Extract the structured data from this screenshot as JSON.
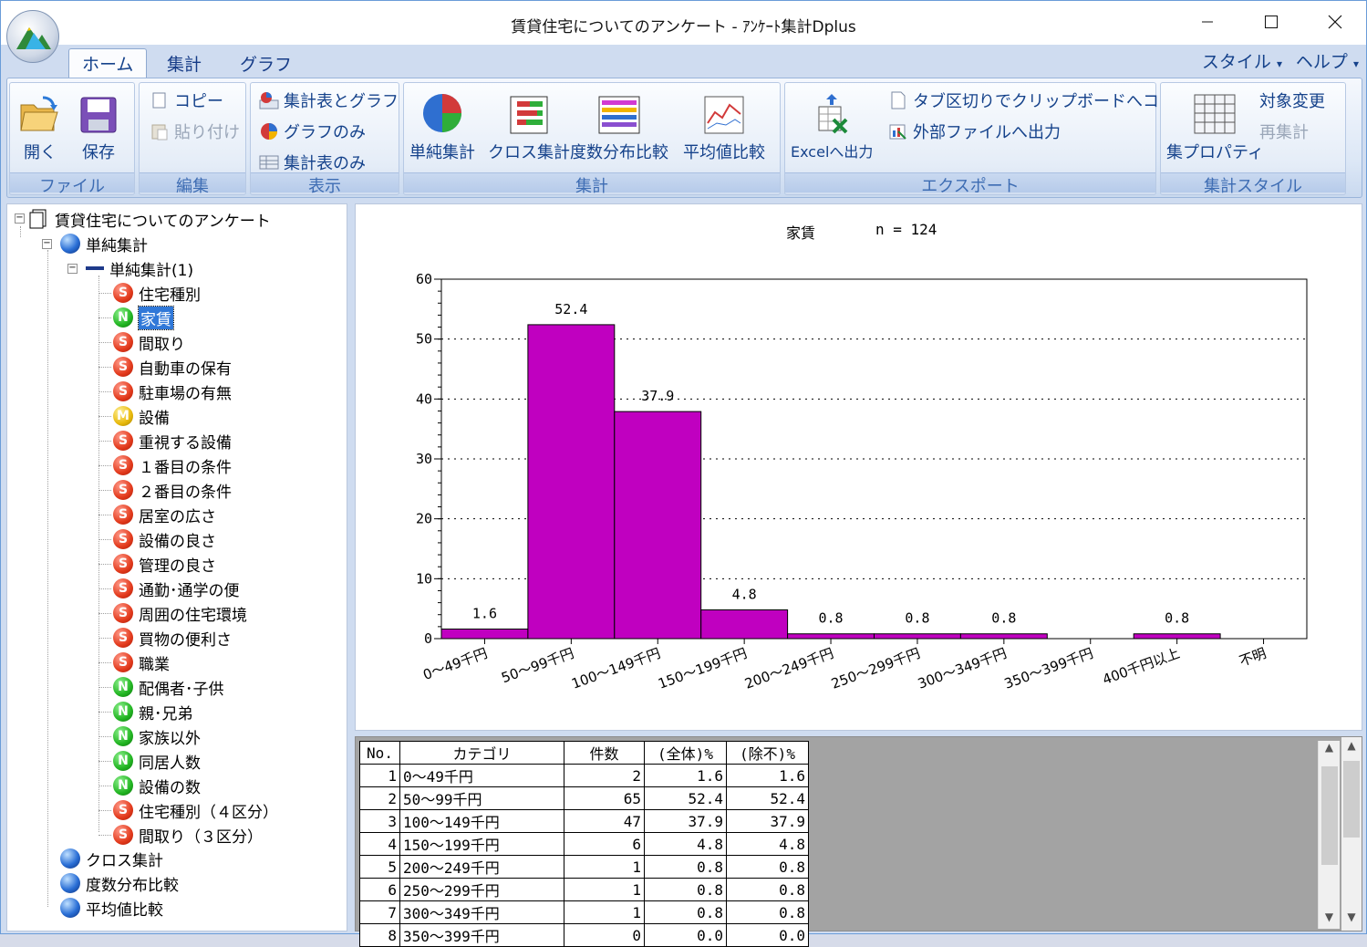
{
  "window": {
    "title": "賃貸住宅についてのアンケート - ｱﾝｹｰﾄ集計Dplus"
  },
  "tabs": {
    "home": "ホーム",
    "tally": "集計",
    "graph": "グラフ",
    "style": "スタイル",
    "help": "ヘルプ"
  },
  "ribbon": {
    "file": {
      "label": "ファイル",
      "open": "開く",
      "save": "保存"
    },
    "edit": {
      "label": "編集",
      "copy": "コピー",
      "paste": "貼り付け"
    },
    "view": {
      "label": "表示",
      "table_graph": "集計表とグラフ",
      "graph_only": "グラフのみ",
      "table_only": "集計表のみ"
    },
    "tally": {
      "label": "集計",
      "simple": "単純集計",
      "cross": "クロス集計",
      "freq": "度数分布比較",
      "mean": "平均値比較"
    },
    "export": {
      "label": "エクスポート",
      "excel": "Excelへ出力",
      "clipboard": "タブ区切りでクリップボードへコピー",
      "external": "外部ファイルへ出力"
    },
    "tally_style": {
      "label": "集計スタイル",
      "props": "集プロパティ",
      "target": "対象変更",
      "recalc": "再集計"
    }
  },
  "tree": {
    "root": "賃貸住宅についてのアンケート",
    "simple": "単純集計",
    "simple1": "単純集計(1)",
    "items": [
      {
        "type": "S",
        "label": "住宅種別"
      },
      {
        "type": "N",
        "label": "家賃",
        "selected": true
      },
      {
        "type": "S",
        "label": "間取り"
      },
      {
        "type": "S",
        "label": "自動車の保有"
      },
      {
        "type": "S",
        "label": "駐車場の有無"
      },
      {
        "type": "M",
        "label": "設備"
      },
      {
        "type": "S",
        "label": "重視する設備"
      },
      {
        "type": "S",
        "label": "１番目の条件"
      },
      {
        "type": "S",
        "label": "２番目の条件"
      },
      {
        "type": "S",
        "label": "居室の広さ"
      },
      {
        "type": "S",
        "label": "設備の良さ"
      },
      {
        "type": "S",
        "label": "管理の良さ"
      },
      {
        "type": "S",
        "label": "通勤･通学の便"
      },
      {
        "type": "S",
        "label": "周囲の住宅環境"
      },
      {
        "type": "S",
        "label": "買物の便利さ"
      },
      {
        "type": "S",
        "label": "職業"
      },
      {
        "type": "N",
        "label": "配偶者･子供"
      },
      {
        "type": "N",
        "label": "親･兄弟"
      },
      {
        "type": "N",
        "label": "家族以外"
      },
      {
        "type": "N",
        "label": "同居人数"
      },
      {
        "type": "N",
        "label": "設備の数"
      },
      {
        "type": "S",
        "label": "住宅種別（４区分）"
      },
      {
        "type": "S",
        "label": "間取り（３区分）"
      }
    ],
    "cross": "クロス集計",
    "freq": "度数分布比較",
    "mean": "平均値比較"
  },
  "chart_header": {
    "title": "家賃",
    "n_label": "n =  124"
  },
  "chart_data": {
    "type": "bar",
    "title": "家賃",
    "categories": [
      "0～49千円",
      "50～99千円",
      "100～149千円",
      "150～199千円",
      "200～249千円",
      "250～299千円",
      "300～349千円",
      "350～399千円",
      "400千円以上",
      "不明"
    ],
    "values": [
      1.6,
      52.4,
      37.9,
      4.8,
      0.8,
      0.8,
      0.8,
      0.0,
      0.8,
      0.0
    ],
    "value_labels": [
      "1.6",
      "52.4",
      "37.9",
      "4.8",
      "0.8",
      "0.8",
      "0.8",
      "",
      "0.8",
      ""
    ],
    "yticks": [
      0,
      10,
      20,
      30,
      40,
      50,
      60
    ],
    "ylim": [
      0,
      60
    ],
    "bar_color": "#c000c0",
    "grid": "horizontal dotted"
  },
  "table": {
    "headers": [
      "No.",
      "カテゴリ",
      "件数",
      "(全体)%",
      "(除不)%"
    ],
    "rows": [
      [
        "1",
        "0～49千円",
        "2",
        "1.6",
        "1.6"
      ],
      [
        "2",
        "50～99千円",
        "65",
        "52.4",
        "52.4"
      ],
      [
        "3",
        "100～149千円",
        "47",
        "37.9",
        "37.9"
      ],
      [
        "4",
        "150～199千円",
        "6",
        "4.8",
        "4.8"
      ],
      [
        "5",
        "200～249千円",
        "1",
        "0.8",
        "0.8"
      ],
      [
        "6",
        "250～299千円",
        "1",
        "0.8",
        "0.8"
      ],
      [
        "7",
        "300～349千円",
        "1",
        "0.8",
        "0.8"
      ],
      [
        "8",
        "350～399千円",
        "0",
        "0.0",
        "0.0"
      ]
    ]
  }
}
